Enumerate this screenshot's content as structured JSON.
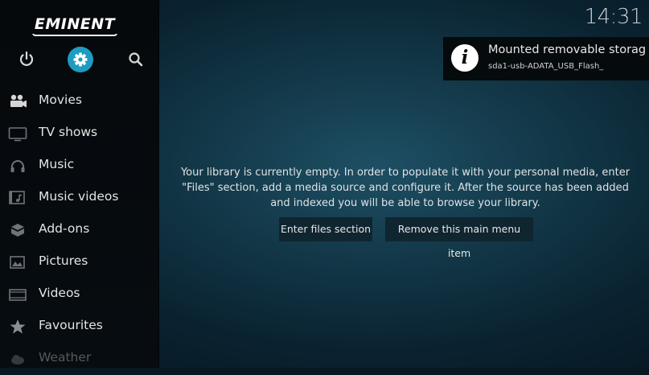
{
  "brand": {
    "logo_text": "EMINENT"
  },
  "clock": {
    "time": "14:31"
  },
  "top_icons": {
    "power": "power-icon",
    "settings": "gear-icon",
    "search": "search-icon",
    "accent": "#1e9bc0"
  },
  "sidebar": {
    "items": [
      {
        "label": "Movies",
        "icon": "movies-icon"
      },
      {
        "label": "TV shows",
        "icon": "tv-icon"
      },
      {
        "label": "Music",
        "icon": "headphones-icon"
      },
      {
        "label": "Music videos",
        "icon": "music-video-icon"
      },
      {
        "label": "Add-ons",
        "icon": "addons-icon"
      },
      {
        "label": "Pictures",
        "icon": "pictures-icon"
      },
      {
        "label": "Videos",
        "icon": "film-icon"
      },
      {
        "label": "Favourites",
        "icon": "star-icon"
      },
      {
        "label": "Weather",
        "icon": "weather-icon"
      }
    ]
  },
  "notification": {
    "title": "Mounted removable storag",
    "subtitle": "sda1-usb-ADATA_USB_Flash_"
  },
  "main": {
    "message_line1": "Your library is currently empty. In order to populate it with your personal media, enter",
    "message_line2": "\"Files\" section, add a media source and configure it. After the source has been added",
    "message_line3": "and indexed you will be able to browse your library.",
    "enter_files_label": "Enter files section",
    "remove_item_label": "Remove this main menu item"
  }
}
